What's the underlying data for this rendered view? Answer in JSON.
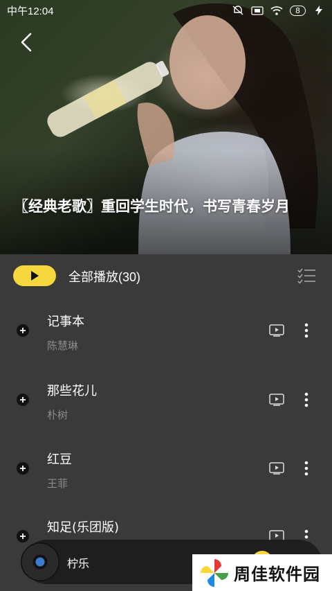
{
  "status_bar": {
    "time": "中午12:04",
    "battery": "8",
    "icons": [
      "mute-icon",
      "sim-icon",
      "wifi-icon",
      "battery-icon",
      "charging-icon"
    ]
  },
  "playlist": {
    "title": "〖经典老歌〗重回学生时代，书写青春岁月",
    "play_all_label": "全部播放(30)"
  },
  "songs": [
    {
      "title": "记事本",
      "artist": "陈慧琳"
    },
    {
      "title": "那些花儿",
      "artist": "朴树"
    },
    {
      "title": "红豆",
      "artist": "王菲"
    },
    {
      "title": "知足(乐团版)",
      "artist": ""
    }
  ],
  "player": {
    "now_playing": "柠乐"
  },
  "watermark": {
    "text": "周佳软件园"
  },
  "colors": {
    "accent": "#f6d73d",
    "background": "#3a3a3a",
    "player_bar": "#1e1e1e",
    "artist_text": "#8c8c8c"
  }
}
